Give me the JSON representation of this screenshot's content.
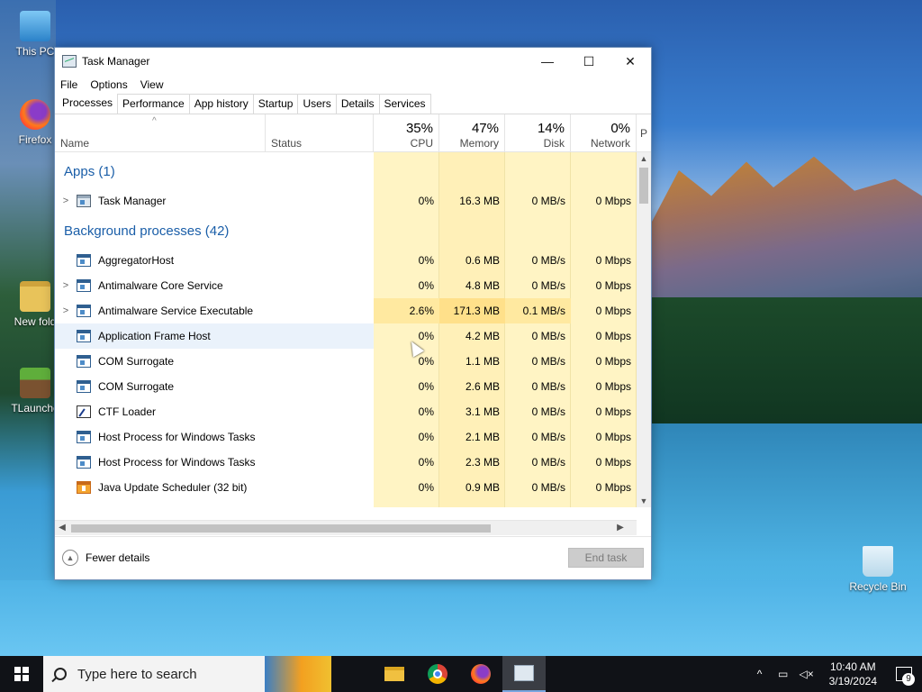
{
  "desktop": {
    "icons": [
      {
        "label": "This PC"
      },
      {
        "label": "Firefox"
      },
      {
        "label": "New fold"
      },
      {
        "label": "TLaunche"
      },
      {
        "label": "Recycle Bin"
      }
    ]
  },
  "window": {
    "title": "Task Manager",
    "controls": {
      "minimize": "—",
      "maximize": "☐",
      "close": "✕"
    },
    "menu": [
      "File",
      "Options",
      "View"
    ],
    "tabs": [
      "Processes",
      "Performance",
      "App history",
      "Startup",
      "Users",
      "Details",
      "Services"
    ],
    "active_tab": "Processes"
  },
  "columns": {
    "name": "Name",
    "status": "Status",
    "cpu": {
      "label": "CPU",
      "pct": "35%"
    },
    "memory": {
      "label": "Memory",
      "pct": "47%"
    },
    "disk": {
      "label": "Disk",
      "pct": "14%"
    },
    "network": {
      "label": "Network",
      "pct": "0%"
    },
    "partial": "P"
  },
  "groups": {
    "apps": "Apps (1)",
    "background": "Background processes (42)"
  },
  "apps": [
    {
      "name": "Task Manager",
      "cpu": "0%",
      "memory": "16.3 MB",
      "disk": "0 MB/s",
      "network": "0 Mbps"
    }
  ],
  "background": [
    {
      "name": "AggregatorHost",
      "cpu": "0%",
      "memory": "0.6 MB",
      "disk": "0 MB/s",
      "network": "0 Mbps"
    },
    {
      "name": "Antimalware Core Service",
      "cpu": "0%",
      "memory": "4.8 MB",
      "disk": "0 MB/s",
      "network": "0 Mbps"
    },
    {
      "name": "Antimalware Service Executable",
      "cpu": "2.6%",
      "memory": "171.3 MB",
      "disk": "0.1 MB/s",
      "network": "0 Mbps"
    },
    {
      "name": "Application Frame Host",
      "cpu": "0%",
      "memory": "4.2 MB",
      "disk": "0 MB/s",
      "network": "0 Mbps"
    },
    {
      "name": "COM Surrogate",
      "cpu": "0%",
      "memory": "1.1 MB",
      "disk": "0 MB/s",
      "network": "0 Mbps"
    },
    {
      "name": "COM Surrogate",
      "cpu": "0%",
      "memory": "2.6 MB",
      "disk": "0 MB/s",
      "network": "0 Mbps"
    },
    {
      "name": "CTF Loader",
      "cpu": "0%",
      "memory": "3.1 MB",
      "disk": "0 MB/s",
      "network": "0 Mbps"
    },
    {
      "name": "Host Process for Windows Tasks",
      "cpu": "0%",
      "memory": "2.1 MB",
      "disk": "0 MB/s",
      "network": "0 Mbps"
    },
    {
      "name": "Host Process for Windows Tasks",
      "cpu": "0%",
      "memory": "2.3 MB",
      "disk": "0 MB/s",
      "network": "0 Mbps"
    },
    {
      "name": "Java Update Scheduler (32 bit)",
      "cpu": "0%",
      "memory": "0.9 MB",
      "disk": "0 MB/s",
      "network": "0 Mbps"
    }
  ],
  "footer": {
    "fewer_details": "Fewer details",
    "end_task": "End task"
  },
  "taskbar": {
    "search_placeholder": "Type here to search",
    "time": "10:40 AM",
    "date": "3/19/2024",
    "notification_count": "9"
  }
}
